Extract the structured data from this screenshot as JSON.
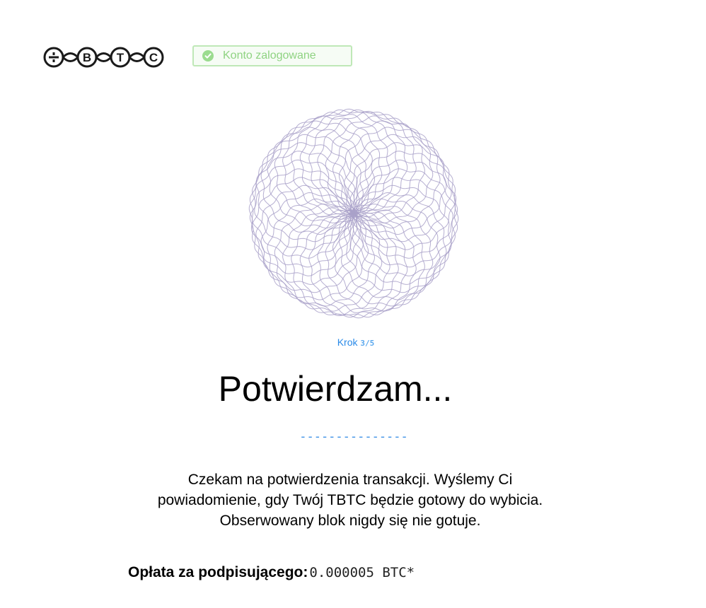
{
  "header": {
    "logo_letters": [
      "B",
      "T",
      "C"
    ],
    "status_badge": "Konto zalogowane"
  },
  "colors": {
    "badge_border": "#bfe8b7",
    "badge_text": "#8fd382",
    "accent_blue": "#2a8ae8",
    "spiro_stroke": "#a9a1c9"
  },
  "icons": [
    "tbtc-logo-icon",
    "check-circle-icon",
    "spirograph-icon"
  ],
  "step": {
    "label": "Krok",
    "count": "3/5"
  },
  "main": {
    "title": "Potwierdzam...",
    "dashes": "---------------",
    "description_lines": [
      "Czekam na potwierdzenia transakcji. Wyślemy Ci",
      "powiadomienie, gdy Twój TBTC będzie gotowy do wybicia.",
      "Obserwowany blok nigdy się nie gotuje."
    ]
  },
  "fee": {
    "label": "Opłata za podpisującego:",
    "value": "0.000005 BTC*"
  }
}
